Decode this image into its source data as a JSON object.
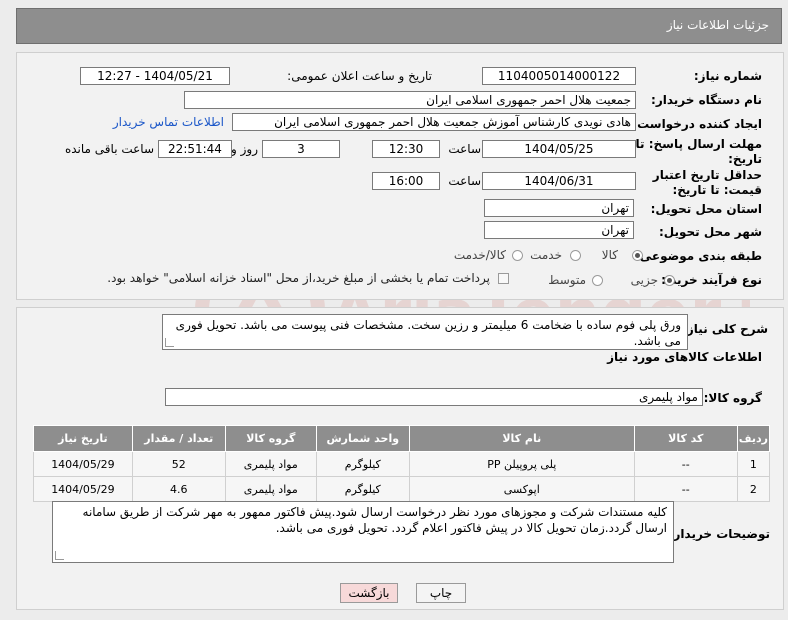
{
  "page_title": "جزئیات اطلاعات نیاز",
  "need_number": {
    "label": "شماره نیاز:",
    "value": "1104005014000122"
  },
  "announce_datetime": {
    "label": "تاریخ و ساعت اعلان عمومی:",
    "value": "1404/05/21 - 12:27"
  },
  "buyer_org": {
    "label": "نام دستگاه خریدار:",
    "value": "جمعیت هلال احمر جمهوری اسلامی ایران"
  },
  "requester": {
    "label": "ایجاد کننده درخواست:",
    "value": "هادی نویدی کارشناس آموزش جمعیت هلال احمر جمهوری اسلامی ایران",
    "contact_link": "اطلاعات تماس خریدار"
  },
  "reply_deadline": {
    "label": "مهلت ارسال پاسخ: تا تاریخ:",
    "date": "1404/05/25",
    "time_label": "ساعت",
    "time": "12:30",
    "days": "3",
    "days_label": "روز و",
    "remaining": "22:51:44",
    "remaining_label": "ساعت باقی مانده"
  },
  "price_validity": {
    "label": "حداقل تاریخ اعتبار قیمت: تا تاریخ:",
    "date": "1404/06/31",
    "time_label": "ساعت",
    "time": "16:00"
  },
  "delivery_province": {
    "label": "استان محل تحویل:",
    "value": "تهران"
  },
  "delivery_city": {
    "label": "شهر محل تحویل:",
    "value": "تهران"
  },
  "category": {
    "label": "طبقه بندی موضوعی:",
    "options": [
      "کالا",
      "خدمت",
      "کالا/خدمت"
    ],
    "selected": "کالا"
  },
  "purchase_type": {
    "label": "نوع فرآیند خرید :",
    "options": [
      "جزیی",
      "متوسط"
    ],
    "payment_note": "پرداخت تمام یا بخشی از مبلغ خرید،از محل \"اسناد خزانه اسلامی\" خواهد بود."
  },
  "general_description": {
    "label": "شرح کلی نیاز:",
    "value": "ورق پلی فوم ساده با ضخامت 6 میلیمتر و رزین سخت. مشخصات فنی پیوست می باشد. تحویل فوری می باشد."
  },
  "goods_info_title": "اطلاعات کالاهای مورد نیاز",
  "goods_group": {
    "label": "گروه کالا:",
    "value": "مواد پلیمری"
  },
  "table": {
    "headers": [
      "ردیف",
      "کد کالا",
      "نام کالا",
      "واحد شمارش",
      "گروه کالا",
      "تعداد / مقدار",
      "تاریخ نیاز"
    ],
    "rows": [
      [
        "1",
        "--",
        "پلی پروپیلن PP",
        "کیلوگرم",
        "مواد پلیمری",
        "52",
        "1404/05/29"
      ],
      [
        "2",
        "--",
        "اپوکسی",
        "کیلوگرم",
        "مواد پلیمری",
        "4.6",
        "1404/05/29"
      ]
    ]
  },
  "buyer_notes": {
    "label": "توضیحات خریدار:",
    "value": "کلیه مستندات شرکت و مجوزهای مورد نظر درخواست ارسال شود.پیش فاکتور ممهور به مهر شرکت از طریق سامانه ارسال گردد.زمان تحویل کالا در پیش فاکتور اعلام گردد. تحویل فوری می باشد."
  },
  "buttons": {
    "print": "چاپ",
    "back": "بازگشت"
  },
  "watermark_text": "AriaTender.neT",
  "colors": {
    "header_bg": "#8e8e8e",
    "link": "#1a56c8",
    "back_button_bg": "#f7d9d9",
    "watermark": "#c0392b"
  }
}
